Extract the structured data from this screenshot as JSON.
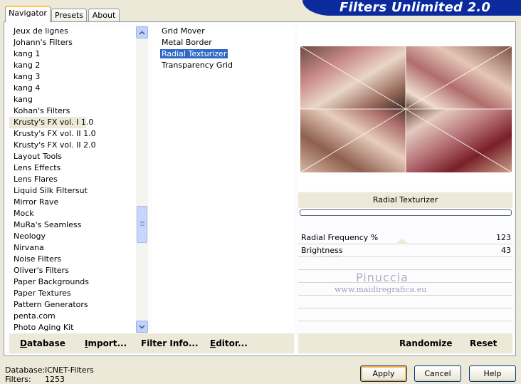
{
  "banner": {
    "title": "Filters Unlimited 2.0"
  },
  "tabs": [
    {
      "label": "Navigator",
      "active": true
    },
    {
      "label": "Presets",
      "active": false
    },
    {
      "label": "About",
      "active": false
    }
  ],
  "categories": {
    "items": [
      "Jeux de lignes",
      "Johann's Filters",
      "kang 1",
      "kang 2",
      "kang 3",
      "kang 4",
      "kang",
      "Kohan's Filters",
      "Krusty's FX vol. I 1.0",
      "Krusty's FX vol. II 1.0",
      "Krusty's FX vol. II 2.0",
      "Layout Tools",
      "Lens Effects",
      "Lens Flares",
      "Liquid Silk Filtersut",
      "Mirror Rave",
      "Mock",
      "MuRa's Seamless",
      "Neology",
      "Nirvana",
      "Noise Filters",
      "Oliver's Filters",
      "Paper Backgrounds",
      "Paper Textures",
      "Pattern Generators",
      "penta.com",
      "Photo Aging Kit"
    ],
    "selected_index": 8
  },
  "filters": {
    "items": [
      "Grid Mover",
      "Metal Border",
      "Radial Texturizer",
      "Transparency Grid"
    ],
    "selected_index": 2
  },
  "preview": {
    "filter_name": "Radial Texturizer"
  },
  "parameters": [
    {
      "label": "Radial Frequency %",
      "value": "123"
    },
    {
      "label": "Brightness",
      "value": "43"
    }
  ],
  "watermark": {
    "line1": "Pinuccia",
    "line2": "www.maidiregrafica.eu"
  },
  "left_buttons": [
    {
      "label": "Database",
      "underline": "D",
      "rest": "atabase"
    },
    {
      "label": "Import...",
      "underline": "I",
      "rest": "mport..."
    },
    {
      "label": "Filter Info...",
      "underline": "",
      "rest": "Filter Info..."
    },
    {
      "label": "Editor...",
      "underline": "E",
      "rest": "ditor..."
    }
  ],
  "right_buttons": {
    "randomize": "Randomize",
    "reset": "Reset"
  },
  "status": {
    "database_label": "Database:",
    "database_value": "ICNET-Filters",
    "filters_label": "Filters:",
    "filters_value": "1253"
  },
  "dialog_buttons": {
    "apply": "Apply",
    "cancel": "Cancel",
    "help": "Help"
  },
  "colors": {
    "banner": "#0a2a9e",
    "selection": "#316ac5",
    "accent_focus": "#f8b54b"
  }
}
